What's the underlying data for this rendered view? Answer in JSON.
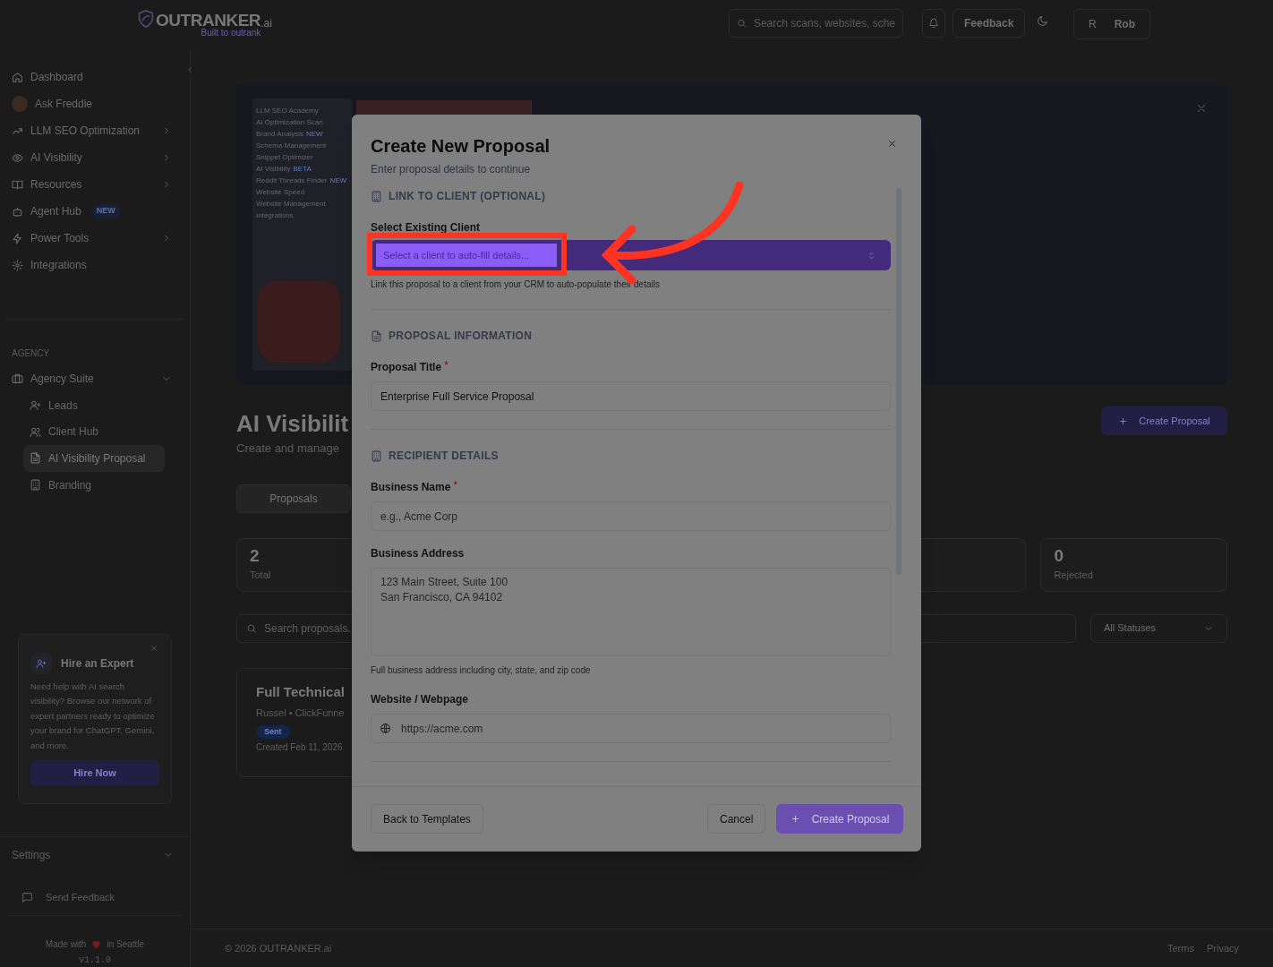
{
  "header": {
    "logo": "OUTRANKER",
    "logo_suffix": ".ai",
    "tagline": "Built to outrank",
    "search": {
      "placeholder": "Search scans, websites, sche"
    },
    "feedback": "Feedback",
    "avatar_initial": "R",
    "user": "Rob"
  },
  "sidebar": {
    "items": [
      {
        "label": "Dashboard",
        "has_submenu": false
      },
      {
        "label": "Ask Freddie",
        "has_submenu": false
      },
      {
        "label": "LLM SEO Optimization",
        "has_submenu": true
      },
      {
        "label": "AI Visibility",
        "has_submenu": true
      },
      {
        "label": "Resources",
        "has_submenu": true
      },
      {
        "label": "Agent Hub",
        "has_submenu": false,
        "badge": "NEW"
      },
      {
        "label": "Power Tools",
        "has_submenu": true
      },
      {
        "label": "Integrations",
        "has_submenu": false
      }
    ],
    "section_heading": "AGENCY",
    "suite": {
      "label": "Agency Suite",
      "expanded": true,
      "children": [
        {
          "label": "Leads",
          "selected": false
        },
        {
          "label": "Client Hub",
          "selected": false
        },
        {
          "label": "AI Visibility Proposal",
          "selected": true
        },
        {
          "label": "Branding",
          "selected": false
        }
      ]
    },
    "promo": {
      "title": "Hire an Expert",
      "body": "Need help with AI search visibility? Browse our network of expert partners ready to optimize your brand for ChatGPT, Gemini, and more.",
      "button": "Hire Now"
    },
    "settings": {
      "label": "Settings",
      "expanded": false
    },
    "send_feedback": "Send Feedback",
    "made_with": {
      "before": "Made with",
      "after": "in Seattle"
    },
    "version": "v1.1.0"
  },
  "main": {
    "banner": {
      "preview_items": [
        {
          "label": "LLM SEO Academy"
        },
        {
          "label": "AI Optimization Scan"
        },
        {
          "label": "Brand Analysis",
          "badge": "NEW"
        },
        {
          "label": "Schema Management"
        },
        {
          "label": "Snippet Optimizer"
        },
        {
          "label": "AI Visibility",
          "badge": "BETA"
        },
        {
          "label": "Reddit Threads Finder",
          "badge": "NEW"
        },
        {
          "label": "Website Speed"
        },
        {
          "label": "Website Management"
        },
        {
          "label": "Integrations"
        }
      ]
    },
    "title": "AI Visibilit",
    "subtitle": "Create and manage",
    "create_button": "Create Proposal",
    "tabs": [
      {
        "label": "Proposals",
        "selected": true
      }
    ],
    "stats": [
      {
        "value": "2",
        "label": "Total"
      },
      {
        "value": "0",
        "label": "Rejected"
      }
    ],
    "search": {
      "placeholder": "Search proposals."
    },
    "status_filter": "All Statuses",
    "proposal": {
      "title": "Full Technical",
      "meta": "Russel • ClickFunne",
      "status": "Sent",
      "created": "Created Feb 11, 2026"
    },
    "footer": {
      "copyright": "© 2026 OUTRANKER.ai",
      "links": [
        "Terms",
        "Privacy"
      ]
    }
  },
  "modal": {
    "title": "Create New Proposal",
    "subtitle": "Enter proposal details to continue",
    "sections": [
      {
        "heading": "LINK TO CLIENT (OPTIONAL)",
        "fields": [
          {
            "kind": "select",
            "label": "Select Existing Client",
            "placeholder": "Select a client to auto-fill details...",
            "help": "Link this proposal to a client from your CRM to auto-populate their details"
          }
        ]
      },
      {
        "heading": "PROPOSAL INFORMATION",
        "fields": [
          {
            "kind": "text",
            "label": "Proposal Title",
            "required_mark": "*",
            "value": "Enterprise Full Service Proposal"
          }
        ]
      },
      {
        "heading": "RECIPIENT DETAILS",
        "fields": [
          {
            "kind": "text",
            "label": "Business Name",
            "required_mark": "*",
            "placeholder": "e.g., Acme Corp"
          },
          {
            "kind": "textarea",
            "label": "Business Address",
            "placeholder": "123 Main Street, Suite 100\nSan Francisco, CA 94102",
            "help": "Full business address including city, state, and zip code"
          },
          {
            "kind": "url",
            "label": "Website / Webpage",
            "placeholder": "https://acme.com"
          }
        ]
      }
    ],
    "back_button": "Back to Templates",
    "cancel_button": "Cancel",
    "submit_button": "Create Proposal"
  },
  "annotation": {
    "kind": "arrow_and_frame"
  }
}
